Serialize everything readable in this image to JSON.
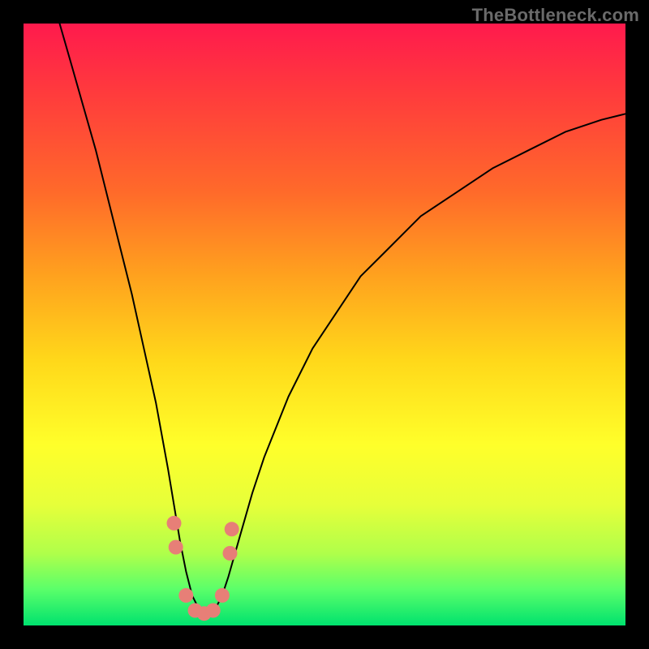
{
  "watermark": "TheBottleneck.com",
  "chart_data": {
    "type": "line",
    "title": "",
    "xlabel": "",
    "ylabel": "",
    "xlim": [
      0,
      100
    ],
    "ylim": [
      0,
      100
    ],
    "grid": false,
    "legend": false,
    "annotations": [],
    "series": [
      {
        "name": "bottleneck-curve",
        "x": [
          6,
          8,
          10,
          12,
          14,
          16,
          18,
          20,
          22,
          24,
          25,
          26,
          27,
          28,
          29,
          30,
          31,
          32,
          33,
          34,
          36,
          38,
          40,
          44,
          48,
          52,
          56,
          60,
          66,
          72,
          78,
          84,
          90,
          96,
          100
        ],
        "y": [
          100,
          93,
          86,
          79,
          71,
          63,
          55,
          46,
          37,
          26,
          20,
          14,
          9,
          5,
          3,
          2,
          2,
          3,
          5,
          8,
          15,
          22,
          28,
          38,
          46,
          52,
          58,
          62,
          68,
          72,
          76,
          79,
          82,
          84,
          85
        ]
      }
    ],
    "markers": {
      "name": "highlight-dots",
      "x": [
        25.0,
        25.3,
        27.0,
        28.5,
        30.0,
        31.5,
        33.0,
        34.3,
        34.6
      ],
      "y": [
        17,
        13,
        5,
        2.5,
        2,
        2.5,
        5,
        12,
        16
      ]
    },
    "background": {
      "type": "vertical-gradient",
      "stops": [
        {
          "pos": 0,
          "color": "#ff1a4d"
        },
        {
          "pos": 28,
          "color": "#ff6a2a"
        },
        {
          "pos": 56,
          "color": "#ffd81a"
        },
        {
          "pos": 80,
          "color": "#e6ff3a"
        },
        {
          "pos": 100,
          "color": "#00e26e"
        }
      ]
    }
  }
}
